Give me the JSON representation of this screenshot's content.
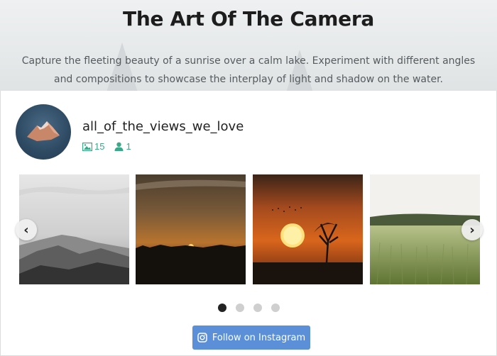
{
  "hero": {
    "title": "The Art Of The Camera",
    "description": "Capture the fleeting beauty of a sunrise over a calm lake. Experiment with different angles and compositions to showcase the interplay of light and shadow on the water."
  },
  "profile": {
    "username": "all_of_the_views_we_love",
    "posts_count": "15",
    "followers_count": "1",
    "posts_icon": "image-icon",
    "followers_icon": "user-icon"
  },
  "gallery": {
    "photos": [
      {
        "name": "misty-mountains",
        "alt": "Misty mountains in grayscale"
      },
      {
        "name": "sunset-horizon",
        "alt": "Sunset over a dark horizon"
      },
      {
        "name": "sun-and-tree",
        "alt": "Setting sun beside a bare tree"
      },
      {
        "name": "wheat-field",
        "alt": "Green wheat field"
      }
    ],
    "prev_label": "‹",
    "next_label": "›",
    "dot_count": 4,
    "active_dot": 0
  },
  "follow_button": {
    "label": "Follow on Instagram",
    "icon": "instagram-icon",
    "color": "#5b8fd8"
  },
  "colors": {
    "accent": "#3ba88a",
    "button": "#5b8fd8"
  }
}
